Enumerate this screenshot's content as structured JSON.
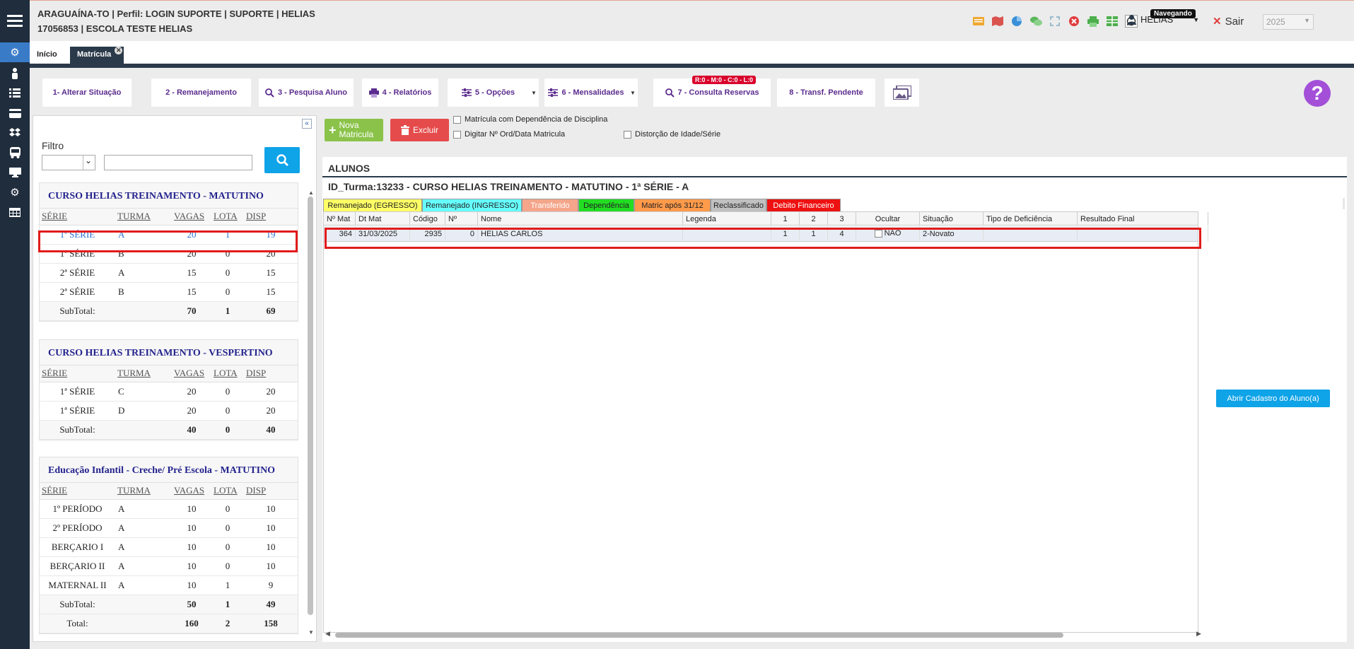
{
  "header": {
    "line1": "ARAGUAÍNA-TO | Perfil: LOGIN SUPORTE | SUPORTE | HELIAS",
    "line2": "17056853 | ESCOLA TESTE HELIAS",
    "user": "HELIAS",
    "navegando": "Navegando",
    "sair": "Sair",
    "year": "2025"
  },
  "tabs": [
    {
      "label": "Início"
    },
    {
      "label": "Matrícula"
    }
  ],
  "toolbar": {
    "b1": "1- Alterar Situação",
    "b2": "2 - Remanejamento",
    "b3": "3 - Pesquisa Aluno",
    "b4": "4 - Relatórios",
    "b5": "5 - Opções",
    "b6": "6 - Mensalidades",
    "b7": "7 - Consulta Reservas",
    "b8": "8 - Transf. Pendente",
    "reservas_badge": "R:0 - M:0 - C:0 - L:0"
  },
  "filter": {
    "label": "Filtro"
  },
  "courses": [
    {
      "title": "CURSO HELIAS TREINAMENTO - MATUTINO",
      "headers": [
        "SÉRIE",
        "TURMA",
        "VAGAS",
        "LOTA",
        "DISP"
      ],
      "rows": [
        [
          "1ª SÉRIE",
          "A",
          "20",
          "1",
          "19"
        ],
        [
          "1ª SÉRIE",
          "B",
          "20",
          "0",
          "20"
        ],
        [
          "2ª SÉRIE",
          "A",
          "15",
          "0",
          "15"
        ],
        [
          "2ª SÉRIE",
          "B",
          "15",
          "0",
          "15"
        ]
      ],
      "subtotal": [
        "SubTotal:",
        "70",
        "1",
        "69"
      ]
    },
    {
      "title": "CURSO HELIAS TREINAMENTO - VESPERTINO",
      "headers": [
        "SÉRIE",
        "TURMA",
        "VAGAS",
        "LOTA",
        "DISP"
      ],
      "rows": [
        [
          "1ª SÉRIE",
          "C",
          "20",
          "0",
          "20"
        ],
        [
          "1ª SÉRIE",
          "D",
          "20",
          "0",
          "20"
        ]
      ],
      "subtotal": [
        "SubTotal:",
        "40",
        "0",
        "40"
      ]
    },
    {
      "title": "Educação Infantil - Creche/ Pré Escola - MATUTINO",
      "headers": [
        "SÉRIE",
        "TURMA",
        "VAGAS",
        "LOTA",
        "DISP"
      ],
      "rows": [
        [
          "1º PERÍODO",
          "A",
          "10",
          "0",
          "10"
        ],
        [
          "2º PERÍODO",
          "A",
          "10",
          "0",
          "10"
        ],
        [
          "BERÇARIO I",
          "A",
          "10",
          "0",
          "10"
        ],
        [
          "BERÇARIO II",
          "A",
          "10",
          "0",
          "10"
        ],
        [
          "MATERNAL II",
          "A",
          "10",
          "1",
          "9"
        ]
      ],
      "subtotal": [
        "SubTotal:",
        "50",
        "1",
        "49"
      ],
      "total": [
        "Total:",
        "160",
        "2",
        "158"
      ]
    }
  ],
  "actions": {
    "nova_line1": "Nova",
    "nova_line2": "Matricula",
    "excluir": "Excluir",
    "chk1": "Matrícula com Dependência de Disciplina",
    "chk2": "Digitar Nº Ord/Data Matricula",
    "chk3": "Distorção de Idade/Série"
  },
  "alunos": {
    "title": "ALUNOS",
    "turma": "ID_Turma:13233 - CURSO HELIAS TREINAMENTO - MATUTINO - 1ª SÉRIE - A",
    "legend": [
      {
        "label": "Remanejado (EGRESSO)",
        "bg": "#ffff66",
        "fg": "#222"
      },
      {
        "label": "Remanejado (INGRESSO)",
        "bg": "#66ffff",
        "fg": "#222"
      },
      {
        "label": "Transferido",
        "bg": "#f4a58a",
        "fg": "#fff"
      },
      {
        "label": "Dependência",
        "bg": "#22dd22",
        "fg": "#222"
      },
      {
        "label": "Matric após 31/12",
        "bg": "#ff9a4a",
        "fg": "#222"
      },
      {
        "label": "Reclassificado",
        "bg": "#c0c0c0",
        "fg": "#222"
      },
      {
        "label": "Debito Financeiro",
        "bg": "#ee1111",
        "fg": "#fff"
      }
    ],
    "columns": [
      "Nº Mat",
      "Dt Mat",
      "Código",
      "Nº",
      "Nome",
      "Legenda",
      "1",
      "2",
      "3",
      "Ocultar",
      "Situação",
      "Tipo de Deficiência",
      "Resultado Final"
    ],
    "row": {
      "nmat": "364",
      "dtmat": "31/03/2025",
      "codigo": "2935",
      "num": "0",
      "nome": "HELIAS CARLOS",
      "legenda": "",
      "c1": "1",
      "c2": "1",
      "c3": "4",
      "ocultar": "NÃO",
      "situacao": "2-Novato",
      "tipo": "",
      "resultado": ""
    },
    "abrir_cadastro": "Abrir Cadastro do Aluno(a)"
  }
}
